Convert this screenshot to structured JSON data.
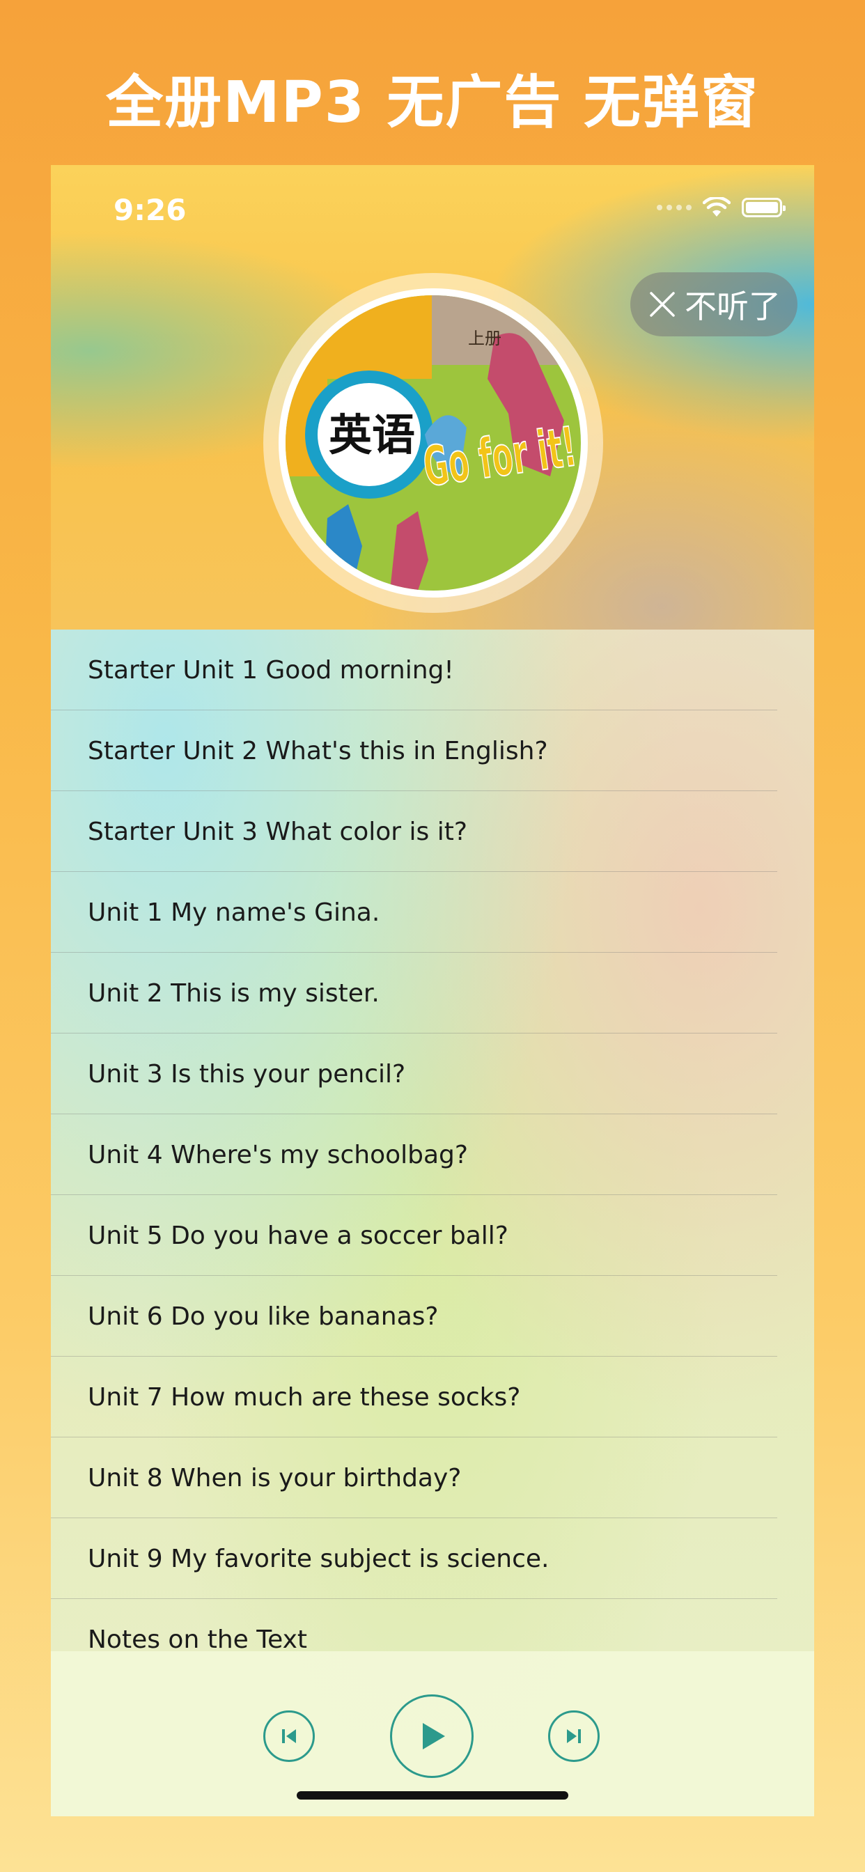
{
  "promo": {
    "title": "全册MP3 无广告 无弹窗"
  },
  "status_bar": {
    "time": "9:26",
    "icons": [
      "signal-dots-icon",
      "wifi-icon",
      "battery-icon"
    ]
  },
  "header": {
    "close_button_label": "不听了"
  },
  "cover": {
    "badge_text": "英语",
    "grade_text": "上册",
    "art_text": "Go for it!"
  },
  "track_list": [
    "Starter Unit 1 Good morning!",
    "Starter Unit 2 What's this in English?",
    "Starter Unit 3 What color is it?",
    "Unit 1 My name's Gina.",
    "Unit 2 This is my sister.",
    "Unit 3 Is this your pencil?",
    "Unit 4 Where's my schoolbag?",
    "Unit 5 Do you have a soccer ball?",
    "Unit 6 Do you like bananas?",
    "Unit 7 How much are these socks?",
    "Unit 8 When is your birthday?",
    "Unit 9 My favorite subject is science.",
    "Notes on the Text"
  ],
  "player": {
    "buttons": [
      "previous-track-icon",
      "play-icon",
      "next-track-icon"
    ],
    "accent_color": "#2c9a8c"
  }
}
